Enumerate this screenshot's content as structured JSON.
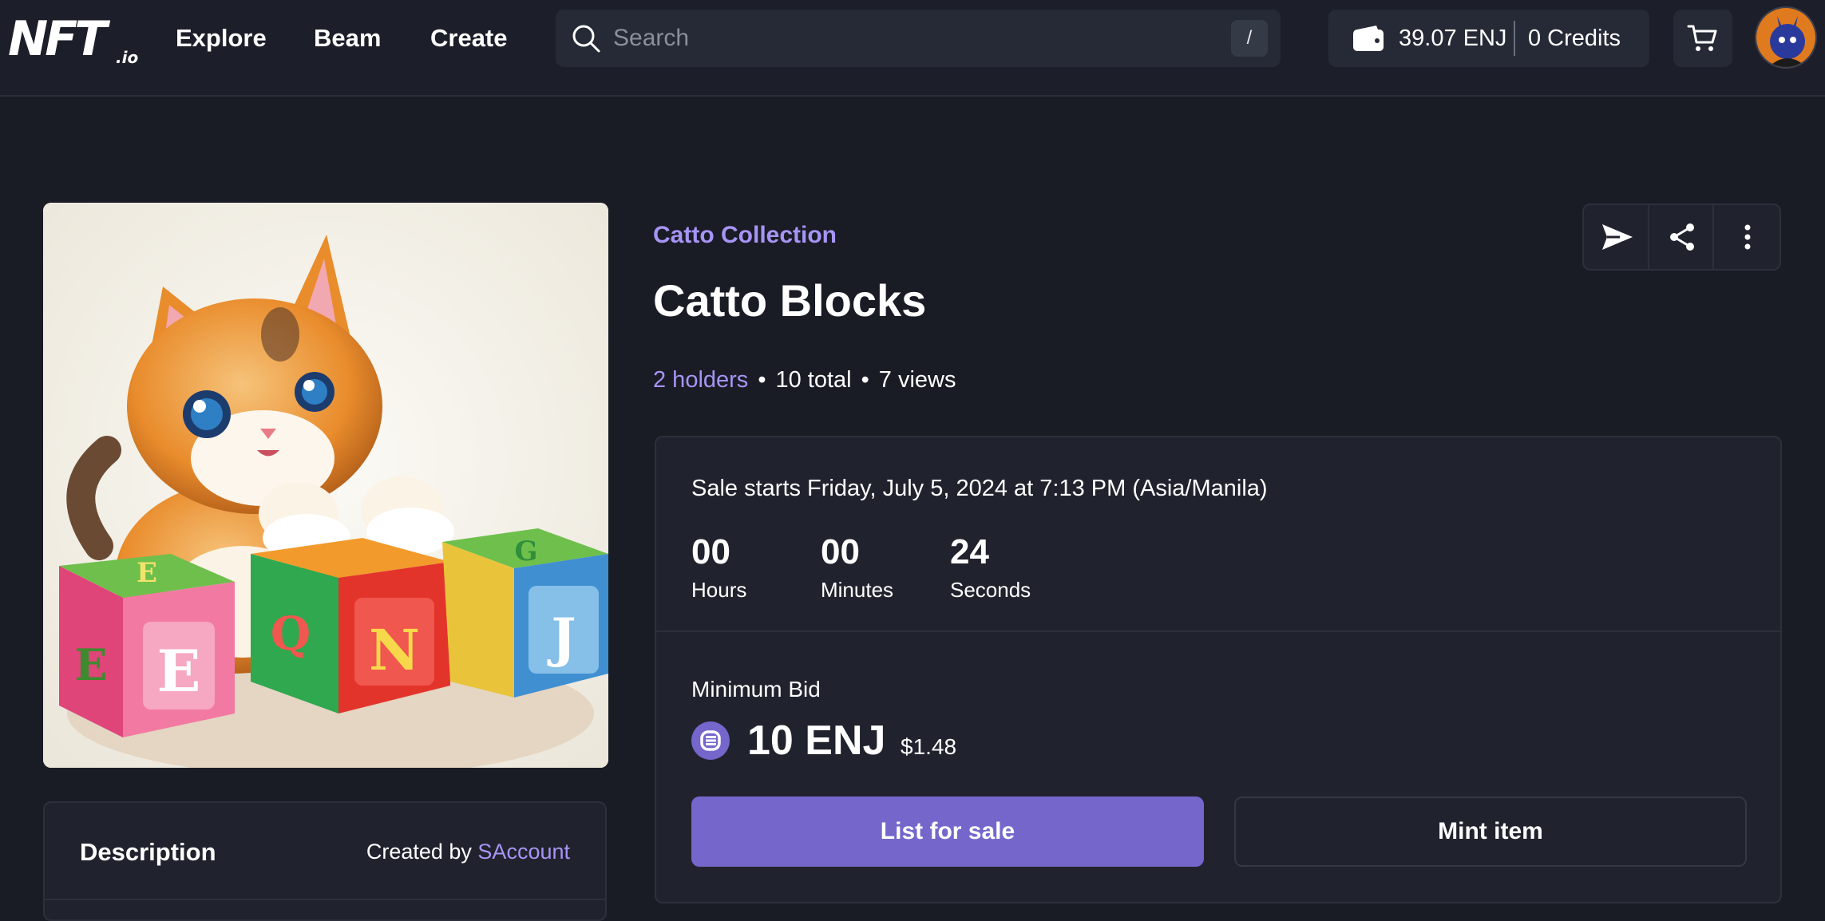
{
  "header": {
    "logo_text": "NFT",
    "logo_suffix": ".io",
    "nav": [
      {
        "label": "Explore"
      },
      {
        "label": "Beam"
      },
      {
        "label": "Create"
      }
    ],
    "search": {
      "placeholder": "Search",
      "shortcut": "/"
    },
    "wallet": {
      "balance": "39.07 ENJ",
      "credits": "0 Credits"
    }
  },
  "item": {
    "collection": "Catto Collection",
    "title": "Catto Blocks",
    "holders": "2 holders",
    "total": "10 total",
    "views": "7 views",
    "image_blocks": [
      "E",
      "E",
      "Q",
      "N",
      "J",
      "E",
      "G"
    ]
  },
  "sale": {
    "starts": "Sale starts Friday, July 5, 2024 at 7:13 PM (Asia/Manila)",
    "countdown": [
      {
        "value": "00",
        "label": "Hours"
      },
      {
        "value": "00",
        "label": "Minutes"
      },
      {
        "value": "24",
        "label": "Seconds"
      }
    ],
    "min_bid_label": "Minimum Bid",
    "price": "10 ENJ",
    "price_usd": "$1.48",
    "list_button": "List for sale",
    "mint_button": "Mint item"
  },
  "description": {
    "title": "Description",
    "created_by": "Created by",
    "creator": "SAccount"
  },
  "colors": {
    "accent": "#7566cc",
    "link": "#a794f5",
    "background": "#191c25",
    "card": "#20232d"
  }
}
